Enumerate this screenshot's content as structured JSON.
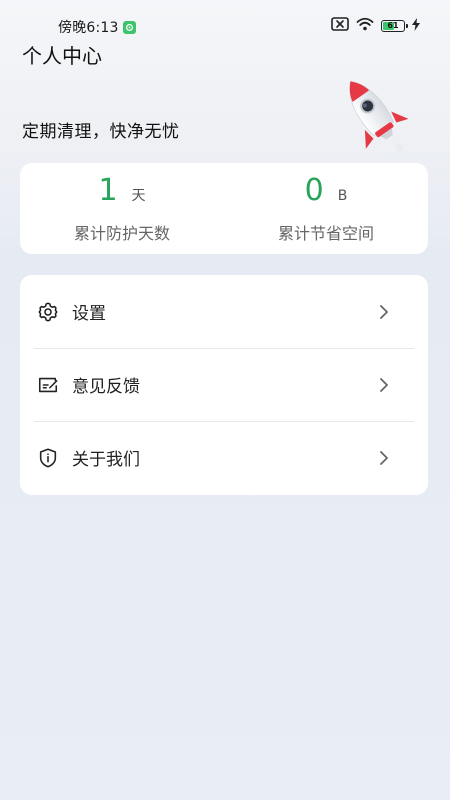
{
  "status_bar": {
    "time": "傍晚6:13",
    "battery_level": "61",
    "battery_fraction": 0.61
  },
  "header": {
    "title": "个人中心",
    "slogan": "定期清理，快净无忧"
  },
  "stats": [
    {
      "value": "1",
      "unit": "天",
      "label": "累计防护天数"
    },
    {
      "value": "0",
      "unit": "B",
      "label": "累计节省空间"
    }
  ],
  "menu": [
    {
      "label": "设置",
      "icon": "gear-icon"
    },
    {
      "label": "意见反馈",
      "icon": "feedback-icon"
    },
    {
      "label": "关于我们",
      "icon": "shield-info-icon"
    }
  ],
  "colors": {
    "accent_green": "#27a35a",
    "rocket_red": "#e53945"
  }
}
